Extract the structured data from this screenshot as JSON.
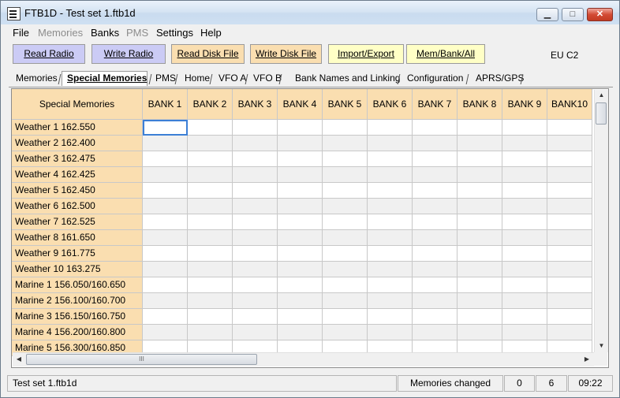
{
  "window": {
    "title": "FTB1D - Test set 1.ftb1d"
  },
  "window_buttons": {
    "minimize": "▁",
    "maximize": "□",
    "close": "✕"
  },
  "menu": [
    "File",
    "Memories",
    "Banks",
    "PMS",
    "Settings",
    "Help"
  ],
  "menu_disabled": [
    "Memories",
    "PMS"
  ],
  "toolbar": {
    "read_radio": "Read Radio",
    "write_radio": "Write Radio",
    "read_disk": "Read Disk File",
    "write_disk": "Write Disk File",
    "import_export": "Import/Export",
    "mem_bank": "Mem/Bank/All",
    "profile": "EU C2"
  },
  "tabs": [
    "Memories",
    "Special Memories",
    "PMS",
    "Home",
    "VFO A",
    "VFO B",
    "Bank Names and Linking",
    "Configuration",
    "APRS/GPS"
  ],
  "active_tab": "Special Memories",
  "grid": {
    "corner_header": "Special Memories",
    "columns": [
      "BANK 1",
      "BANK 2",
      "BANK 3",
      "BANK 4",
      "BANK 5",
      "BANK 6",
      "BANK 7",
      "BANK 8",
      "BANK 9",
      "BANK10"
    ],
    "rows": [
      "Weather 1 162.550",
      "Weather 2 162.400",
      "Weather 3 162.475",
      "Weather 4 162.425",
      "Weather 5 162.450",
      "Weather 6 162.500",
      "Weather 7 162.525",
      "Weather 8 161.650",
      "Weather 9 161.775",
      "Weather 10 163.275",
      "Marine 1 156.050/160.650",
      "Marine 2 156.100/160.700",
      "Marine 3 156.150/160.750",
      "Marine 4 156.200/160.800",
      "Marine 5 156.300/160.850"
    ]
  },
  "scroll": {
    "up": "▲",
    "down": "▼",
    "left": "◀",
    "right": "▶",
    "grip": "III"
  },
  "status": {
    "file": "Test set 1.ftb1d",
    "message": "Memories changed",
    "count1": "0",
    "count2": "6",
    "time": "09:22"
  },
  "colors": {
    "header_bg": "#fadeb0",
    "radio_btn_bg": "#cbcbf5",
    "disk_btn_bg": "#fadeb0",
    "import_btn_bg": "#ffffc6",
    "selection": "#3c7fd6"
  }
}
